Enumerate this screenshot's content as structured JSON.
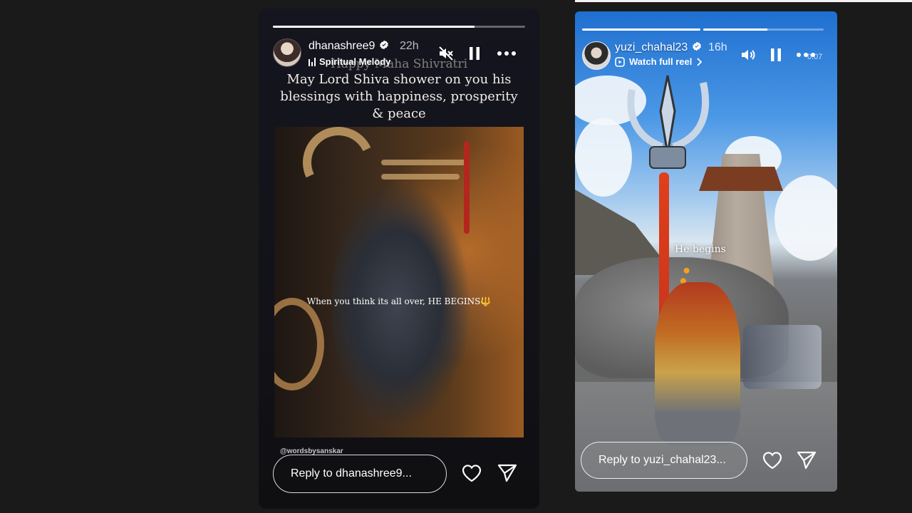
{
  "story1": {
    "username": "dhanashree9",
    "time": "22h",
    "music": "Spiritual Melody",
    "progress": 0.8,
    "greeting_faded": "Happy Maha Shivratri",
    "greeting": "May Lord Shiva shower on you his blessings with happiness, prosperity & peace",
    "art_caption": "When you think its all over, HE BEGINS",
    "art_caption_icon": "🔱",
    "handle": "@wordsbysanskar",
    "reply_placeholder": "Reply to dhanashree9...",
    "icons": {
      "verified": "verified-badge-icon",
      "mute": "muted-speaker-icon",
      "pause": "pause-icon",
      "more": "more-options-icon",
      "like": "heart-icon",
      "send": "send-icon"
    }
  },
  "story2": {
    "username": "yuzi_chahal23",
    "time": "16h",
    "watch_reel": "Watch full reel",
    "duration": "0:07",
    "progress": [
      1.0,
      0.53
    ],
    "overlay_text": "He begins",
    "reply_placeholder": "Reply to yuzi_chahal23...",
    "icons": {
      "verified": "verified-badge-icon",
      "volume": "speaker-icon",
      "pause": "pause-icon",
      "more": "more-options-icon",
      "reel": "reel-icon",
      "like": "heart-icon",
      "send": "send-icon"
    }
  },
  "colors": {
    "background": "#1a1a1a",
    "story_bg": "#121218",
    "verified_blue": "#ffffff"
  }
}
